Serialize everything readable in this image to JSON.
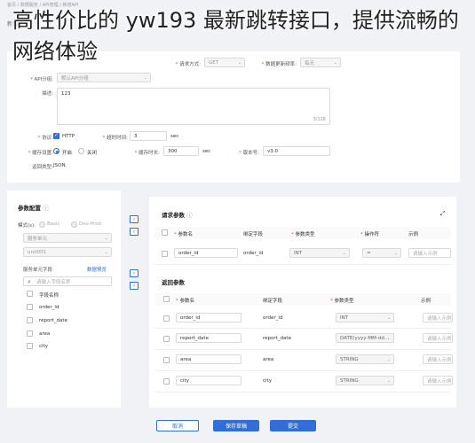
{
  "breadcrumb": "首页 / 数据服务 / API管理 / 新增API",
  "page_title": "新增API",
  "overlay_title": "高性价比的 yw193 最新跳转接口，提供流畅的网络体验",
  "form": {
    "request_method_label": "请求方式:",
    "request_method_value": "GET",
    "data_format_label": "数据更新频率:",
    "data_format_value": "每天",
    "group_label": "API分组:",
    "group_value": "默认API分组",
    "desc_label": "描述:",
    "desc_value": "123",
    "desc_counter": "3/128",
    "protocol_label": "协议:",
    "protocol_value": "HTTP",
    "timeout_label": "超时时间:",
    "timeout_value": "3",
    "timeout_unit": "sec",
    "cache_label": "缓存设置:",
    "cache_on": "开启",
    "cache_off": "关闭",
    "cache_time_label": "缓存时长:",
    "cache_time_value": "300",
    "cache_time_unit": "sec",
    "version_label": "版本号:",
    "version_value": "v3.0",
    "return_type_label": "返回类型:",
    "return_type_value": "JSON"
  },
  "param_config": {
    "title": "参数配置",
    "mode_label": "模式(s):",
    "mode_basic": "Basic",
    "mode_devprod": "Dev-Prod",
    "service_unit_placeholder": "服务单元",
    "unit_value": "unit001",
    "table_field_label": "服务单元字段",
    "data_preview_link": "数据预览",
    "search_placeholder": "请输入字段名称",
    "field_header": "字段名称",
    "fields": [
      "order_id",
      "report_date",
      "area",
      "city"
    ]
  },
  "request_params": {
    "title": "请求参数",
    "headers": [
      "参数名",
      "绑定字段",
      "参数类型",
      "操作符",
      "示例"
    ],
    "rows": [
      {
        "name": "order_id",
        "bind": "order_id",
        "type": "INT",
        "op": "=",
        "example": "请输入示例"
      }
    ]
  },
  "return_params": {
    "title": "返回参数",
    "headers": [
      "参数名",
      "绑定字段",
      "参数类型",
      "示例"
    ],
    "rows": [
      {
        "name": "order_id",
        "bind": "order_id",
        "type": "INT",
        "example": "请输入示例"
      },
      {
        "name": "report_date",
        "bind": "report_date",
        "type": "DATE(yyyy-MM-dd...",
        "example": "请输入示例"
      },
      {
        "name": "area",
        "bind": "area",
        "type": "STRING",
        "example": "请输入示例"
      },
      {
        "name": "city",
        "bind": "city",
        "type": "STRING",
        "example": "请输入示例"
      }
    ]
  },
  "footer": {
    "cancel": "取消",
    "save_draft": "保存草稿",
    "submit": "提交"
  }
}
